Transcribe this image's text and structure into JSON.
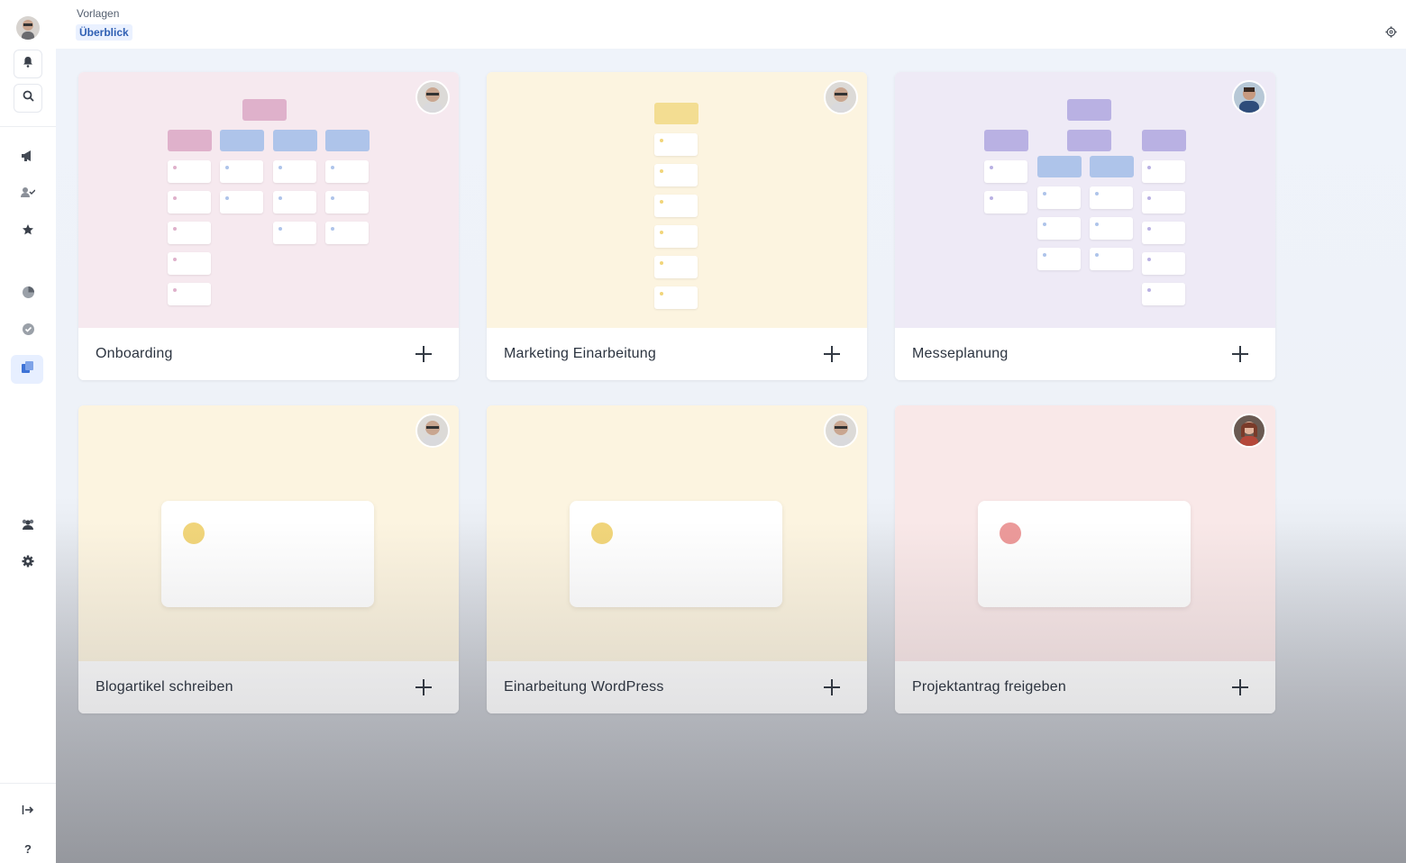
{
  "header": {
    "breadcrumb": "Vorlagen",
    "active_tab": "Überblick"
  },
  "sidebar": {
    "items": [
      {
        "icon": "user-avatar"
      },
      {
        "icon": "bell-icon"
      },
      {
        "icon": "search-icon"
      },
      {
        "icon": "megaphone-icon"
      },
      {
        "icon": "user-check-icon"
      },
      {
        "icon": "star-icon"
      },
      {
        "icon": "pie-chart-icon"
      },
      {
        "icon": "check-circle-icon"
      },
      {
        "icon": "templates-icon"
      },
      {
        "icon": "team-icon"
      },
      {
        "icon": "gear-icon"
      },
      {
        "icon": "logout-icon"
      },
      {
        "icon": "help-icon"
      }
    ],
    "help_label": "?"
  },
  "templates": [
    {
      "title": "Onboarding",
      "bg": "#f6e9ef"
    },
    {
      "title": "Marketing Einarbeitung",
      "bg": "#fcf4e0"
    },
    {
      "title": "Messeplanung",
      "bg": "#eeeaf6"
    },
    {
      "title": "Blogartikel schreiben",
      "bg": "#fcf4e0"
    },
    {
      "title": "Einarbeitung WordPress",
      "bg": "#fcf4e0"
    },
    {
      "title": "Projektantrag freigeben",
      "bg": "#f9e8e8"
    }
  ],
  "colors": {
    "pink": "#dfb1cb",
    "blue": "#aec4ea",
    "yellow": "#f3dd92",
    "purple": "#b9b1e3",
    "accent": "#2f5fb3",
    "dot_yellow": "#f1d57a",
    "dot_red": "#ec9a9a"
  }
}
